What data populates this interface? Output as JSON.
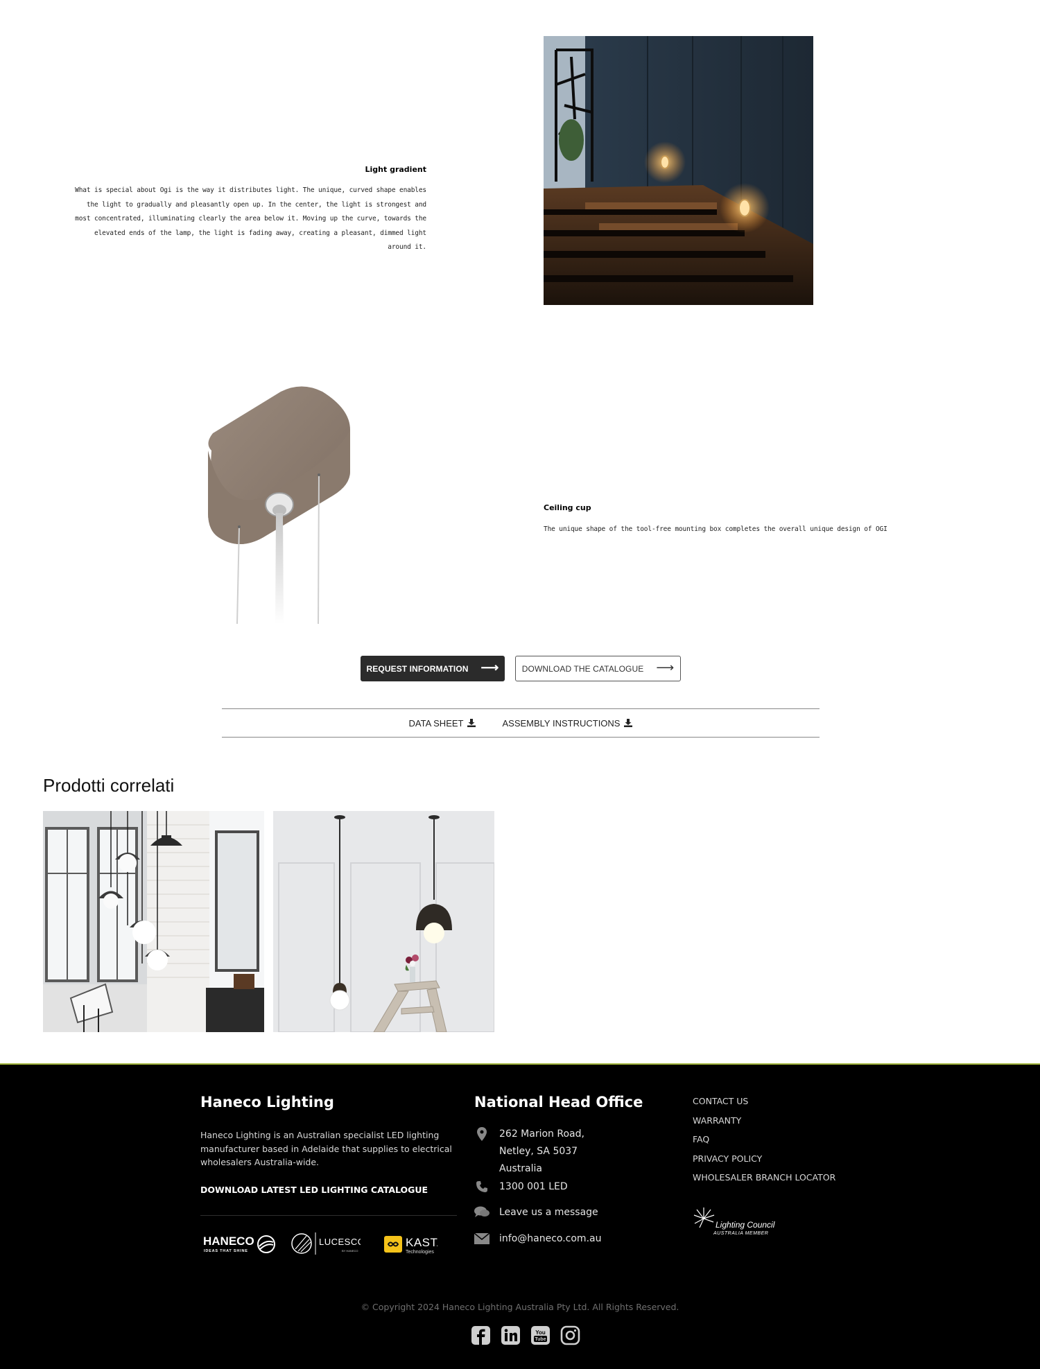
{
  "features": [
    {
      "title": "Light gradient",
      "body": "What is special about Ogi is the way it distributes light. The unique, curved shape enables the light to gradually and pleasantly open up. In the center, the light is strongest and most concentrated, illuminating clearly the area below it. Moving up the curve, towards the elevated ends of the lamp, the light is fading away, creating a pleasant, dimmed light around it."
    },
    {
      "title": "Ceiling cup",
      "body": "The unique shape of the tool-free mounting box completes the overall unique design of OGI"
    }
  ],
  "cta": {
    "request_label": "REQUEST INFORMATION",
    "catalogue_label": "DOWNLOAD THE CATALOGUE"
  },
  "downloads": {
    "data_sheet": "DATA SHEET",
    "assembly": "ASSEMBLY INSTRUCTIONS"
  },
  "related": {
    "title": "Prodotti correlati"
  },
  "footer": {
    "about_title": "Haneco Lighting",
    "about_text": "Haneco Lighting is an Australian specialist LED lighting manufacturer based in Adelaide that supplies to electrical wholesalers Australia-wide.",
    "download_link": "DOWNLOAD LATEST LED LIGHTING CATALOGUE",
    "brands": {
      "haneco": "HANECO",
      "haneco_tagline": "IDEAS THAT SHINE",
      "lucesco": "LUCESCO",
      "lucesco_tagline": "BY HANECO",
      "kasta": "KASTA",
      "kasta_tagline": "Technologies"
    },
    "office_title": "National Head Office",
    "address_lines": [
      "262 Marion Road,",
      "Netley, SA 5037",
      "Australia"
    ],
    "phone": "1300 001 LED",
    "message": "Leave us a message",
    "email": "info@haneco.com.au",
    "links": [
      "CONTACT US",
      "WARRANTY",
      "FAQ",
      "PRIVACY POLICY",
      "WHOLESALER BRANCH LOCATOR"
    ],
    "council": {
      "name": "Lighting Council",
      "sub": "AUSTRALIA MEMBER"
    },
    "copyright": "© Copyright 2024 Haneco Lighting Australia Pty Ltd. All Rights Reserved.",
    "social": [
      "facebook-icon",
      "linkedin-icon",
      "youtube-icon",
      "instagram-icon"
    ]
  },
  "colors": {
    "footer_bg": "#000000",
    "footer_accent_line": "#9fb23a",
    "button_dark": "#2b2b2b",
    "council_text": "#ffffff"
  }
}
